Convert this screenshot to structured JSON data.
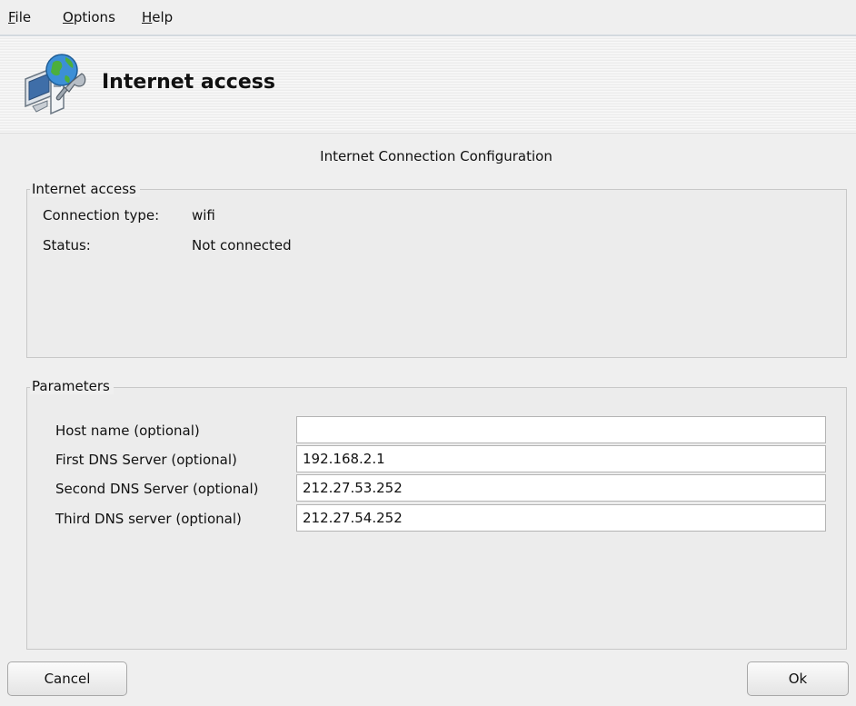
{
  "menu": [
    {
      "mnemonic": "F",
      "rest": "ile"
    },
    {
      "mnemonic": "O",
      "rest": "ptions"
    },
    {
      "mnemonic": "H",
      "rest": "elp"
    }
  ],
  "header": {
    "title": "Internet access",
    "icon": "network-wrench-icon"
  },
  "subtitle": "Internet Connection Configuration",
  "internet_access": {
    "legend": "Internet access",
    "rows": [
      {
        "label": "Connection type:",
        "value": "wifi"
      },
      {
        "label": "Status:",
        "value": "Not connected"
      }
    ]
  },
  "parameters": {
    "legend": "Parameters",
    "fields": [
      {
        "label": "Host name (optional)",
        "value": ""
      },
      {
        "label": "First DNS Server (optional)",
        "value": "192.168.2.1"
      },
      {
        "label": "Second DNS Server (optional)",
        "value": "212.27.53.252"
      },
      {
        "label": "Third DNS server (optional)",
        "value": "212.27.54.252"
      }
    ]
  },
  "buttons": {
    "cancel": "Cancel",
    "ok": "Ok"
  }
}
